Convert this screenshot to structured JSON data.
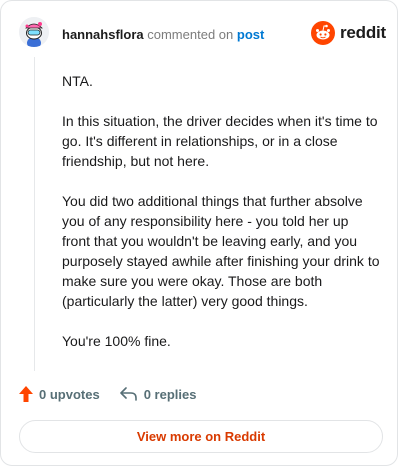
{
  "header": {
    "username": "hannahsflora",
    "action_text": "commented on",
    "post_link": "post"
  },
  "brand": {
    "wordmark": "reddit",
    "accent_color": "#ff4500"
  },
  "comment": {
    "paragraphs": [
      "NTA.",
      "In this situation, the driver decides when it's time to go. It's different in relationships, or in a close friendship, but not here.",
      "You did two additional things that further absolve you of any responsibility here - you told her up front that you wouldn't be leaving early, and you purposely stayed awhile after finishing your drink to make sure you were okay. Those are both (particularly the latter) very good things.",
      "You're 100% fine."
    ]
  },
  "actions": {
    "upvotes_label": "0 upvotes",
    "upvote_icon": "upvote-arrow-icon",
    "upvote_color": "#ff4500",
    "replies_label": "0 replies",
    "reply_icon": "reply-arrow-icon"
  },
  "footer": {
    "view_more_label": "View more on Reddit",
    "link_color": "#d93a00"
  }
}
